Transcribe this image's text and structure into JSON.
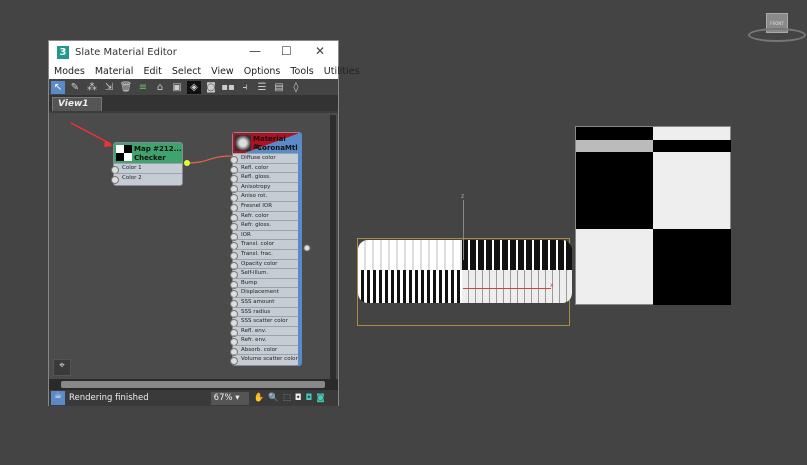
{
  "window": {
    "title": "Slate Material Editor",
    "app_icon": "3",
    "minimize": "—",
    "maximize": "☐",
    "close": "✕"
  },
  "menu": [
    "Modes",
    "Material",
    "Edit",
    "Select",
    "View",
    "Options",
    "Tools",
    "Utilities"
  ],
  "toolbar_icons": [
    "select-icon",
    "eyedropper-icon",
    "pick-material-icon",
    "put-material-icon",
    "delete-icon",
    "move-children-icon",
    "hide-unused-icon",
    "show-map-icon",
    "show-background-icon",
    "layout-icon",
    "layout-children-icon",
    "hide-slots-icon",
    "sort-icon",
    "material-map-browser-icon",
    "navigator-icon"
  ],
  "tab": "View1",
  "checker_node": {
    "title": "Map #212...",
    "subtitle": "Checker",
    "ports": [
      "Color 1",
      "Color 2"
    ],
    "header_color": "#3fa36e"
  },
  "material_node": {
    "title": "Material #...",
    "subtitle": "CoronaMtl",
    "header_color": "#b01020",
    "ports": [
      "Diffuse color",
      "Refl. color",
      "Refl. gloss.",
      "Anisotropy",
      "Aniso rot.",
      "Fresnel IOR",
      "Refr. color",
      "Refr. gloss.",
      "IOR",
      "Transl. color",
      "Transl. frac.",
      "Opacity color",
      "Self-illum.",
      "Bump",
      "Displacement",
      "SSS amount",
      "SSS radius",
      "SSS scatter color",
      "Refl. env.",
      "Refr. env.",
      "Absorb. color",
      "Volume scatter color"
    ]
  },
  "status": {
    "text": "Rendering finished",
    "zoom": "67%"
  },
  "viewcube": {
    "label": "FRONT"
  },
  "gizmo": {
    "z": "z",
    "x": "x"
  }
}
